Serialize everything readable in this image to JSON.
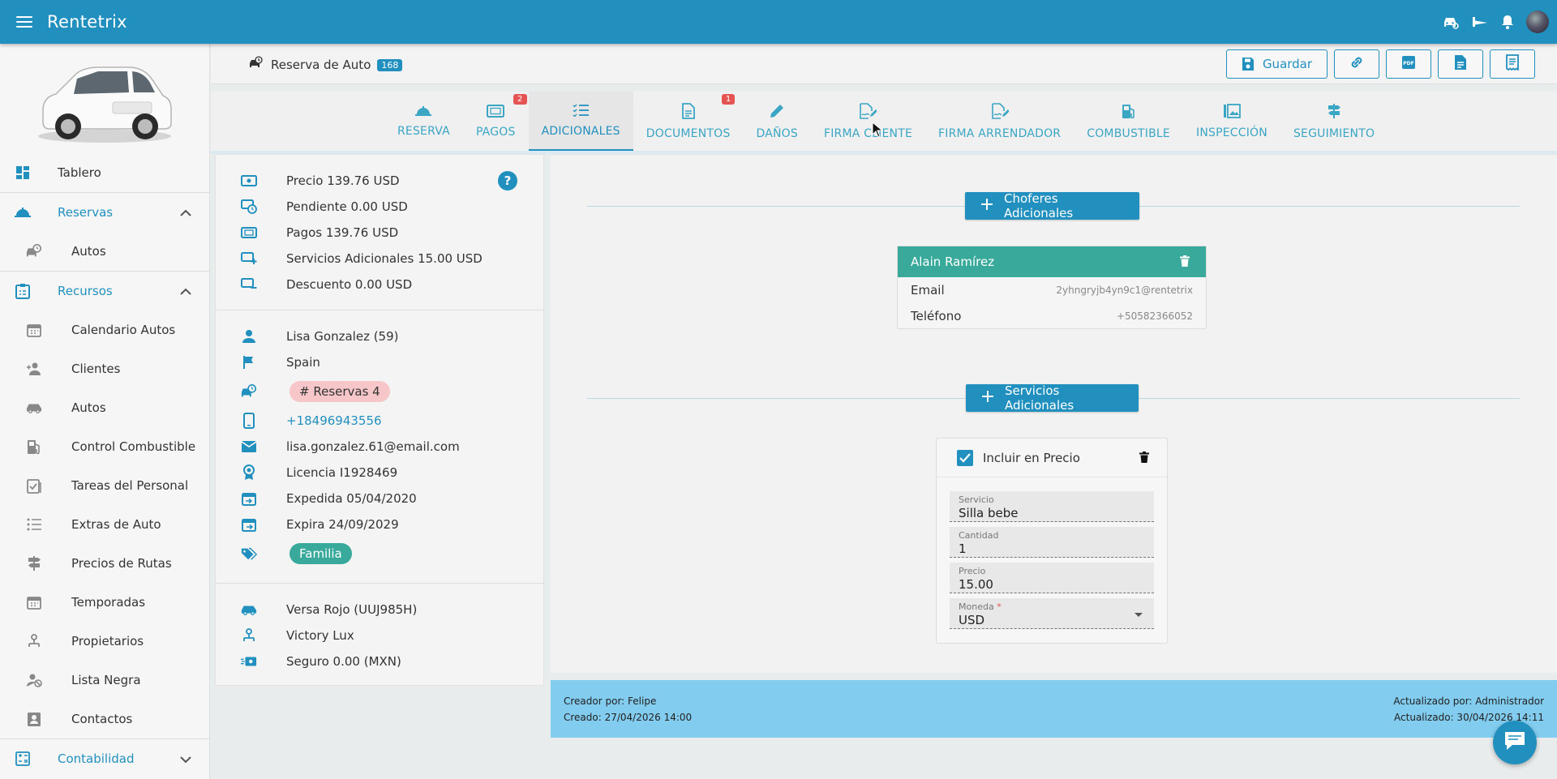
{
  "app": {
    "title": "Rentetrix"
  },
  "sidebar": {
    "items": [
      {
        "label": "Tablero",
        "icon": "dashboard-icon"
      },
      {
        "label": "Reservas",
        "icon": "reservations-icon",
        "group": true,
        "expanded": true
      },
      {
        "label": "Autos",
        "icon": "car-clock-icon",
        "sub": true
      },
      {
        "label": "Recursos",
        "icon": "clipboard-icon",
        "group": true,
        "expanded": true
      },
      {
        "label": "Calendario Autos",
        "icon": "calendar-icon",
        "sub": true
      },
      {
        "label": "Clientes",
        "icon": "users-icon",
        "sub": true
      },
      {
        "label": "Autos",
        "icon": "car-icon",
        "sub": true
      },
      {
        "label": "Control Combustible",
        "icon": "fuel-icon",
        "sub": true
      },
      {
        "label": "Tareas del Personal",
        "icon": "tasks-icon",
        "sub": true
      },
      {
        "label": "Extras de Auto",
        "icon": "list-icon",
        "sub": true
      },
      {
        "label": "Precios de Rutas",
        "icon": "signpost-icon",
        "sub": true
      },
      {
        "label": "Temporadas",
        "icon": "calendar-icon",
        "sub": true
      },
      {
        "label": "Propietarios",
        "icon": "owner-icon",
        "sub": true
      },
      {
        "label": "Lista Negra",
        "icon": "blacklist-icon",
        "sub": true
      },
      {
        "label": "Contactos",
        "icon": "contacts-icon",
        "sub": true
      },
      {
        "label": "Contabilidad",
        "icon": "accounting-icon",
        "group": true,
        "expanded": false
      }
    ]
  },
  "header": {
    "title": "Reserva de Auto",
    "badge": "168",
    "save_label": "Guardar"
  },
  "tabs": [
    {
      "label": "Reserva",
      "icon": "reservation-icon",
      "active": false,
      "count": ""
    },
    {
      "label": "Pagos",
      "icon": "payments-icon",
      "active": false,
      "count": "2"
    },
    {
      "label": "Adicionales",
      "icon": "list-icon",
      "active": true,
      "count": ""
    },
    {
      "label": "Documentos",
      "icon": "document-icon",
      "active": false,
      "count": "1"
    },
    {
      "label": "Daños",
      "icon": "pencil-icon",
      "active": false,
      "count": ""
    },
    {
      "label": "Firma Cliente",
      "icon": "signature-icon",
      "active": false,
      "count": ""
    },
    {
      "label": "Firma Arrendador",
      "icon": "signature-icon",
      "active": false,
      "count": ""
    },
    {
      "label": "Combustible",
      "icon": "fuel-icon",
      "active": false,
      "count": ""
    },
    {
      "label": "Inspección",
      "icon": "gallery-icon",
      "active": false,
      "count": ""
    },
    {
      "label": "Seguimiento",
      "icon": "signpost-icon",
      "active": false,
      "count": ""
    }
  ],
  "summary": {
    "precio": "Precio 139.76 USD",
    "pendiente": "Pendiente 0.00 USD",
    "pagos": "Pagos 139.76 USD",
    "servicios": "Servicios Adicionales 15.00 USD",
    "descuento": "Descuento 0.00 USD",
    "help": "?"
  },
  "client": {
    "name": "Lisa Gonzalez (59)",
    "country": "Spain",
    "reservas": "# Reservas 4",
    "phone": "+18496943556",
    "email": "lisa.gonzalez.61@email.com",
    "license": "Licencia I1928469",
    "issued": "Expedida 05/04/2020",
    "expires": "Expira 24/09/2029",
    "tag": "Familia"
  },
  "vehicle": {
    "car": "Versa Rojo (UUJ985H)",
    "owner": "Victory Lux",
    "insurance": "Seguro 0.00 (MXN)"
  },
  "drivers": {
    "add_label": "Choferes Adicionales",
    "items": [
      {
        "name": "Alain Ramírez",
        "email_label": "Email",
        "email": "2yhngryjb4yn9c1@rentetrix",
        "phone_label": "Teléfono",
        "phone": "+50582366052"
      }
    ]
  },
  "services": {
    "add_label": "Servicios Adicionales",
    "items": [
      {
        "include_label": "Incluir en Precio",
        "servicio_label": "Servicio",
        "servicio": "Silla bebe",
        "cantidad_label": "Cantidad",
        "cantidad": "1",
        "precio_label": "Precio",
        "precio": "15.00",
        "moneda_label": "Moneda",
        "moneda": "USD"
      }
    ]
  },
  "footer": {
    "creator": "Creador por: Felipe",
    "created": "Creado: 27/04/2026 14:00",
    "updater": "Actualizado por: Administrador",
    "updated": "Actualizado: 30/04/2026 14:11"
  },
  "colors": {
    "primary": "#2190bf",
    "teal": "#38a99b",
    "badge_red": "#e55353",
    "footer_bg": "#82ccef",
    "pill_pink": "#f6c6c8"
  }
}
